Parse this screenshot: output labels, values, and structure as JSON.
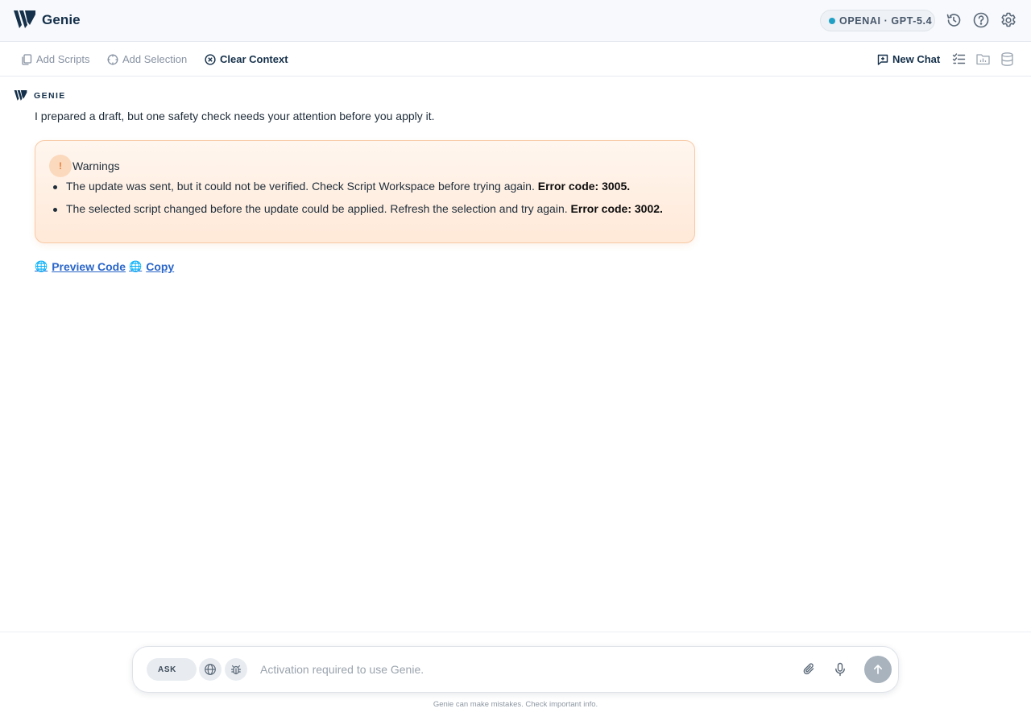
{
  "app": {
    "title": "Genie",
    "model": {
      "label": "OPENAI · GPT-5.4",
      "status_color": "#21a0c6"
    },
    "header_icons": [
      "history-icon",
      "help-icon",
      "settings-icon"
    ]
  },
  "toolbar": {
    "add_scripts": "Add Scripts",
    "add_selection": "Add Selection",
    "clear_context": "Clear Context",
    "new_chat": "New Chat",
    "right_icons": [
      "checklist-icon",
      "folder-chart-icon",
      "database-icon"
    ]
  },
  "chat": {
    "author": "GENIE",
    "message": "I prepared a draft, but one safety check needs your attention before you apply it.",
    "warnings": {
      "title": "Warnings",
      "icon": "!",
      "items": [
        {
          "text": "The update was sent, but it could not be verified. Check Script Workspace before trying again.",
          "code": "Error code: 3005."
        },
        {
          "text": "The selected script changed before the update could be applied. Refresh the selection and try again.",
          "code": "Error code: 3002."
        }
      ]
    },
    "actions": {
      "preview": "Preview Code",
      "copy": "Copy",
      "icon": "🌐"
    }
  },
  "composer": {
    "mode": "ASK",
    "placeholder": "Activation required to use Genie.",
    "disclaimer": "Genie can make mistakes. Check important info."
  },
  "colors": {
    "accent": "#15304a",
    "link": "#2a66c9",
    "warning_bg": "#ffeedf",
    "warning_border": "#f7c9a4"
  }
}
